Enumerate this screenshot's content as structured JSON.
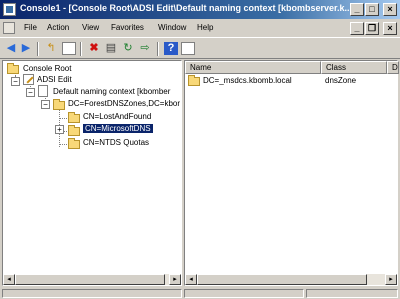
{
  "window": {
    "title": "Console1 - [Console Root\\ADSI Edit\\Default naming context [kbombserver.k...",
    "minimize": "_",
    "maximize": "□",
    "close": "×"
  },
  "inner": {
    "minimize": "_",
    "restore": "❐",
    "close": "×"
  },
  "menu": [
    "File",
    "Action",
    "View",
    "Favorites",
    "Window",
    "Help"
  ],
  "toolbar": {
    "icons": [
      "back-icon",
      "forward-icon",
      "up-icon",
      "show-hide-tree-icon",
      "delete-icon",
      "properties-icon",
      "refresh-icon",
      "export-icon",
      "help-icon",
      "mmc-icon"
    ]
  },
  "tree": {
    "root": "Console Root",
    "adsi": "ADSI Edit",
    "default_nc": "Default naming context [kbomber",
    "forest_dns": "DC=ForestDNSZones,DC=kbor",
    "lost_found": "CN=LostAndFound",
    "microsoft_dns": "CN=MicrosoftDNS",
    "ntds_quotas": "CN=NTDS Quotas",
    "minus": "−",
    "plus": "+"
  },
  "list": {
    "columns": [
      "Name",
      "Class",
      "D"
    ],
    "rows": [
      {
        "name": "DC=_msdcs.kbomb.local",
        "class": "dnsZone"
      }
    ]
  },
  "colors": {
    "title_active": "#0a246a",
    "selection": "#0a246a",
    "folder": "#f8d878",
    "face": "#d4d0c8"
  }
}
